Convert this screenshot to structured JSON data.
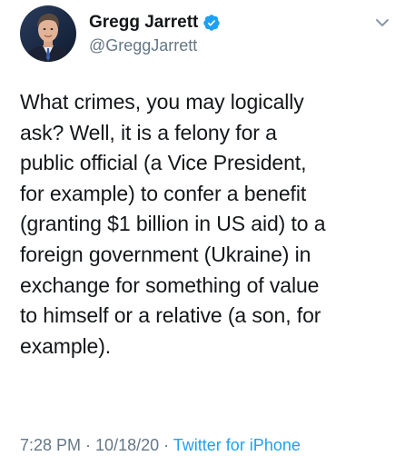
{
  "author": {
    "display_name": "Gregg Jarrett",
    "handle": "@GreggJarrett",
    "verified": true,
    "avatar_icon": "profile-photo"
  },
  "tweet": {
    "text": "What crimes, you may logically\nask?  Well, it is a felony for a\npublic official (a Vice President,\nfor example) to confer a benefit\n(granting $1 billion in US aid) to a\nforeign government (Ukraine) in\nexchange for something of value\nto himself or a relative (a son, for\nexample)."
  },
  "meta": {
    "time": "7:28 PM",
    "separator": " · ",
    "date": "10/18/20",
    "source": "Twitter for iPhone"
  },
  "colors": {
    "text": "#14171a",
    "secondary": "#657786",
    "accent": "#1da1f2"
  },
  "icons": {
    "verified": "verified-badge-icon",
    "menu": "chevron-down-icon"
  }
}
